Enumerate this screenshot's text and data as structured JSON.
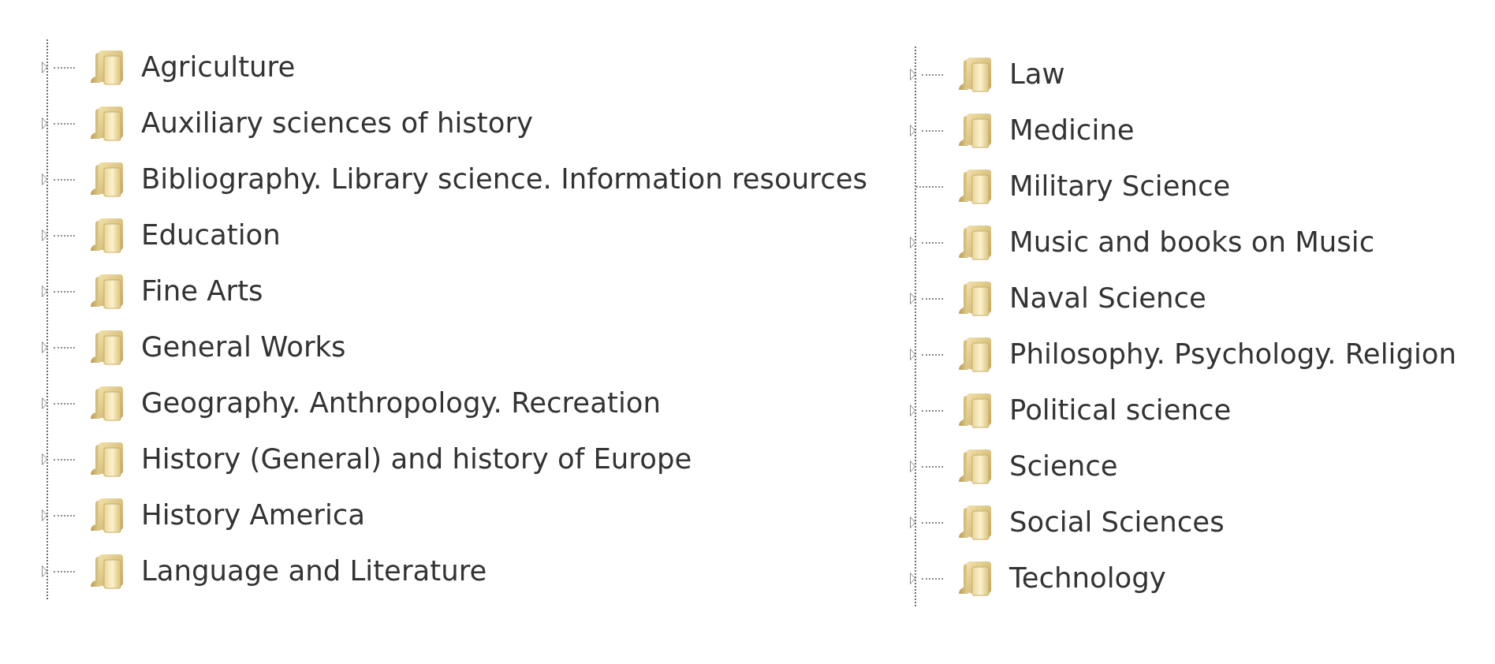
{
  "tree_columns": [
    {
      "items": [
        {
          "label": "Agriculture",
          "expandable": true
        },
        {
          "label": "Auxiliary sciences of history",
          "expandable": true
        },
        {
          "label": "Bibliography. Library science. Information resources",
          "expandable": true
        },
        {
          "label": "Education",
          "expandable": true
        },
        {
          "label": "Fine Arts",
          "expandable": true
        },
        {
          "label": "General Works",
          "expandable": true
        },
        {
          "label": "Geography. Anthropology. Recreation",
          "expandable": true
        },
        {
          "label": "History (General) and history of Europe",
          "expandable": true
        },
        {
          "label": "History America",
          "expandable": true
        },
        {
          "label": "Language and Literature",
          "expandable": true
        }
      ]
    },
    {
      "items": [
        {
          "label": "Law",
          "expandable": true
        },
        {
          "label": "Medicine",
          "expandable": true
        },
        {
          "label": "Military Science",
          "expandable": false
        },
        {
          "label": "Music and books on Music",
          "expandable": true
        },
        {
          "label": "Naval Science",
          "expandable": true
        },
        {
          "label": "Philosophy. Psychology. Religion",
          "expandable": true
        },
        {
          "label": "Political science",
          "expandable": true
        },
        {
          "label": "Science",
          "expandable": true
        },
        {
          "label": "Social Sciences",
          "expandable": true
        },
        {
          "label": "Technology",
          "expandable": true
        }
      ]
    }
  ]
}
